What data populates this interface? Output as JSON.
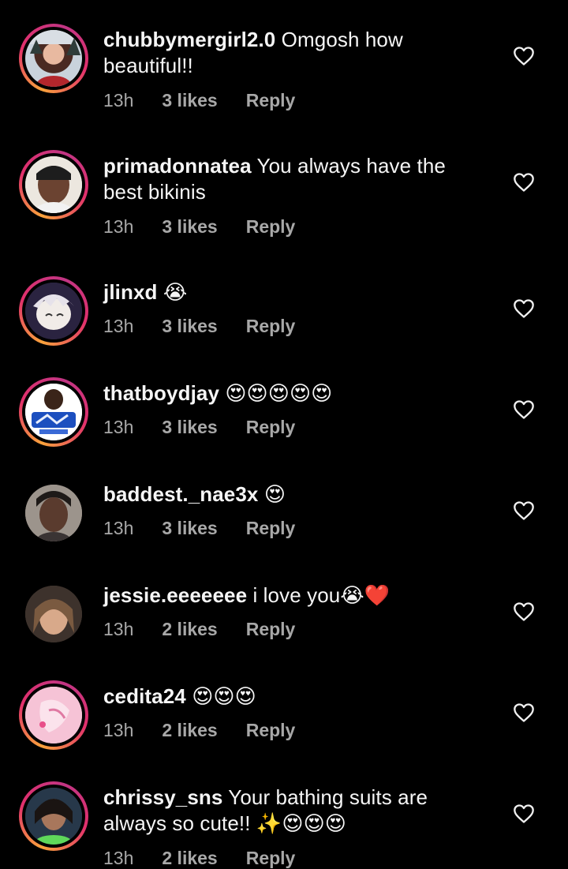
{
  "icons": {
    "like": "heart-outline-icon"
  },
  "comments": [
    {
      "username": "chubbymergirl2.0",
      "text": "Omgosh how beautiful!!",
      "time": "13h",
      "likes": "3 likes",
      "reply": "Reply",
      "ring": true
    },
    {
      "username": "primadonnatea",
      "text": "You always have the best bikinis",
      "time": "13h",
      "likes": "3 likes",
      "reply": "Reply",
      "ring": true
    },
    {
      "username": "jlinxd",
      "text": "😭",
      "time": "13h",
      "likes": "3 likes",
      "reply": "Reply",
      "ring": true
    },
    {
      "username": "thatboydjay",
      "text": "😍😍😍😍😍",
      "time": "13h",
      "likes": "3 likes",
      "reply": "Reply",
      "ring": true
    },
    {
      "username": "baddest._nae3x",
      "text": "😍",
      "time": "13h",
      "likes": "3 likes",
      "reply": "Reply",
      "ring": false
    },
    {
      "username": "jessie.eeeeeee",
      "text": "i love you😭❤️",
      "time": "13h",
      "likes": "2 likes",
      "reply": "Reply",
      "ring": false
    },
    {
      "username": "cedita24",
      "text": "😍😍😍",
      "time": "13h",
      "likes": "2 likes",
      "reply": "Reply",
      "ring": true
    },
    {
      "username": "chrissy_sns",
      "text": "Your bathing suits are always so cute!! ✨😍😍😍",
      "time": "13h",
      "likes": "2 likes",
      "reply": "Reply",
      "ring": true
    }
  ]
}
